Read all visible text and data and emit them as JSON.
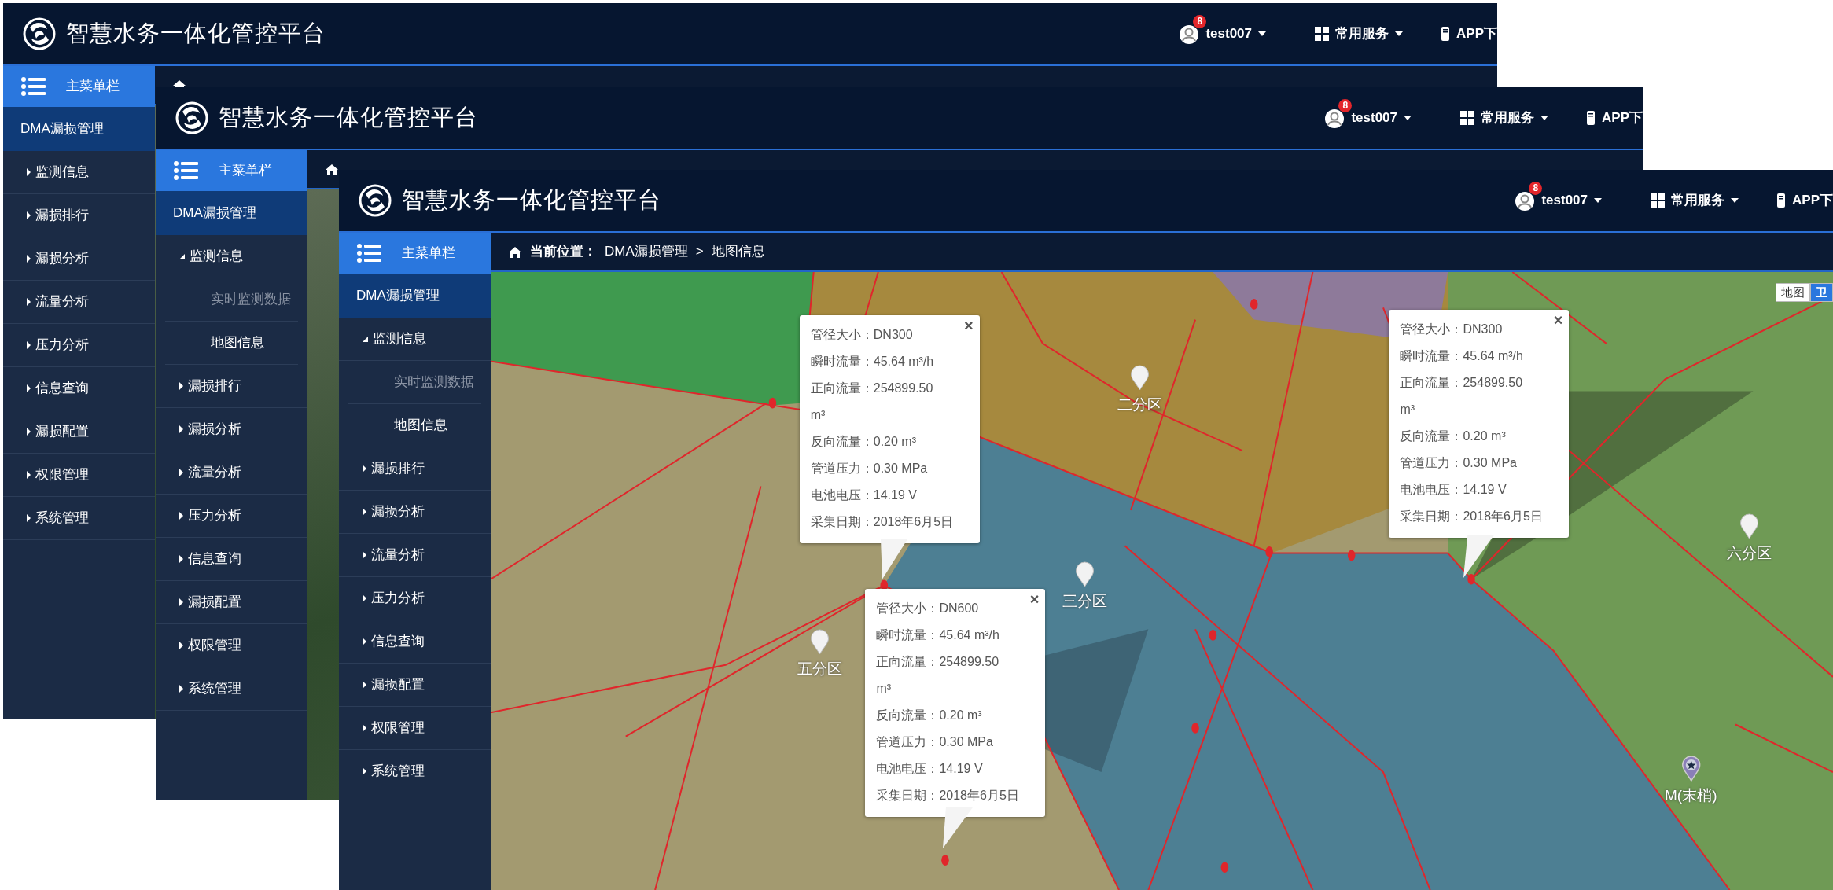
{
  "windows": [
    {
      "header": {
        "title": "智慧水务一体化管控平台",
        "notification_count": "8",
        "user": "test007",
        "services": "常用服务",
        "app_download": "APP下"
      },
      "sidebar": {
        "heading": "主菜单栏",
        "section": "DMA漏损管理",
        "items": [
          {
            "label": "监测信息",
            "expanded": false
          },
          {
            "label": "漏损排行",
            "expanded": false
          },
          {
            "label": "漏损分析",
            "expanded": false
          },
          {
            "label": "流量分析",
            "expanded": false
          },
          {
            "label": "压力分析",
            "expanded": false
          },
          {
            "label": "信息查询",
            "expanded": false
          },
          {
            "label": "漏损配置",
            "expanded": false
          },
          {
            "label": "权限管理",
            "expanded": false
          },
          {
            "label": "系统管理",
            "expanded": false
          }
        ]
      }
    },
    {
      "header": {
        "title": "智慧水务一体化管控平台",
        "notification_count": "8",
        "user": "test007",
        "services": "常用服务",
        "app_download": "APP下"
      },
      "sidebar": {
        "heading": "主菜单栏",
        "section": "DMA漏损管理",
        "items": [
          {
            "label": "监测信息",
            "expanded": true,
            "children": [
              {
                "label": "实时监测数据",
                "selected": false
              },
              {
                "label": "地图信息",
                "selected": true
              }
            ]
          },
          {
            "label": "漏损排行",
            "expanded": false
          },
          {
            "label": "漏损分析",
            "expanded": false
          },
          {
            "label": "流量分析",
            "expanded": false
          },
          {
            "label": "压力分析",
            "expanded": false
          },
          {
            "label": "信息查询",
            "expanded": false
          },
          {
            "label": "漏损配置",
            "expanded": false
          },
          {
            "label": "权限管理",
            "expanded": false
          },
          {
            "label": "系统管理",
            "expanded": false
          }
        ]
      }
    },
    {
      "header": {
        "title": "智慧水务一体化管控平台",
        "notification_count": "8",
        "user": "test007",
        "services": "常用服务",
        "app_download": "APP下"
      },
      "sidebar": {
        "heading": "主菜单栏",
        "section": "DMA漏损管理",
        "items": [
          {
            "label": "监测信息",
            "expanded": true,
            "children": [
              {
                "label": "实时监测数据",
                "selected": false
              },
              {
                "label": "地图信息",
                "selected": true
              }
            ]
          },
          {
            "label": "漏损排行",
            "expanded": false
          },
          {
            "label": "漏损分析",
            "expanded": false
          },
          {
            "label": "流量分析",
            "expanded": false
          },
          {
            "label": "压力分析",
            "expanded": false
          },
          {
            "label": "信息查询",
            "expanded": false
          },
          {
            "label": "漏损配置",
            "expanded": false
          },
          {
            "label": "权限管理",
            "expanded": false
          },
          {
            "label": "系统管理",
            "expanded": false
          }
        ]
      },
      "breadcrumb": {
        "label": "当前位置：",
        "separator": ">",
        "path": [
          "DMA漏损管理",
          "地图信息"
        ]
      },
      "map": {
        "map_types": [
          {
            "label": "地图",
            "selected": false
          },
          {
            "label": "卫",
            "selected": true
          }
        ],
        "places": [
          {
            "label": "二分区",
            "kind": "district"
          },
          {
            "label": "三分区",
            "kind": "district"
          },
          {
            "label": "五分区",
            "kind": "district"
          },
          {
            "label": "六分区",
            "kind": "district"
          },
          {
            "label": "M(末梢)",
            "kind": "endpoint"
          }
        ],
        "popups": [
          {
            "close": "×",
            "rows": [
              "管径大小：DN300",
              "瞬时流量：45.64 m³/h",
              "正向流量：254899.50 m³",
              "反向流量：0.20 m³",
              "管道压力：0.30 MPa",
              "电池电压：14.19 V",
              "采集日期：2018年6月5日"
            ]
          },
          {
            "close": "×",
            "rows": [
              "管径大小：DN600",
              "瞬时流量：45.64 m³/h",
              "正向流量：254899.50 m³",
              "反向流量：0.20 m³",
              "管道压力：0.30 MPa",
              "电池电压：14.19 V",
              "采集日期：2018年6月5日"
            ]
          },
          {
            "close": "×",
            "rows": [
              "管径大小：DN300",
              "瞬时流量：45.64 m³/h",
              "正向流量：254899.50 m³",
              "反向流量：0.20 m³",
              "管道压力：0.30 MPa",
              "电池电压：14.19 V",
              "采集日期：2018年6月5日"
            ]
          }
        ]
      }
    }
  ]
}
